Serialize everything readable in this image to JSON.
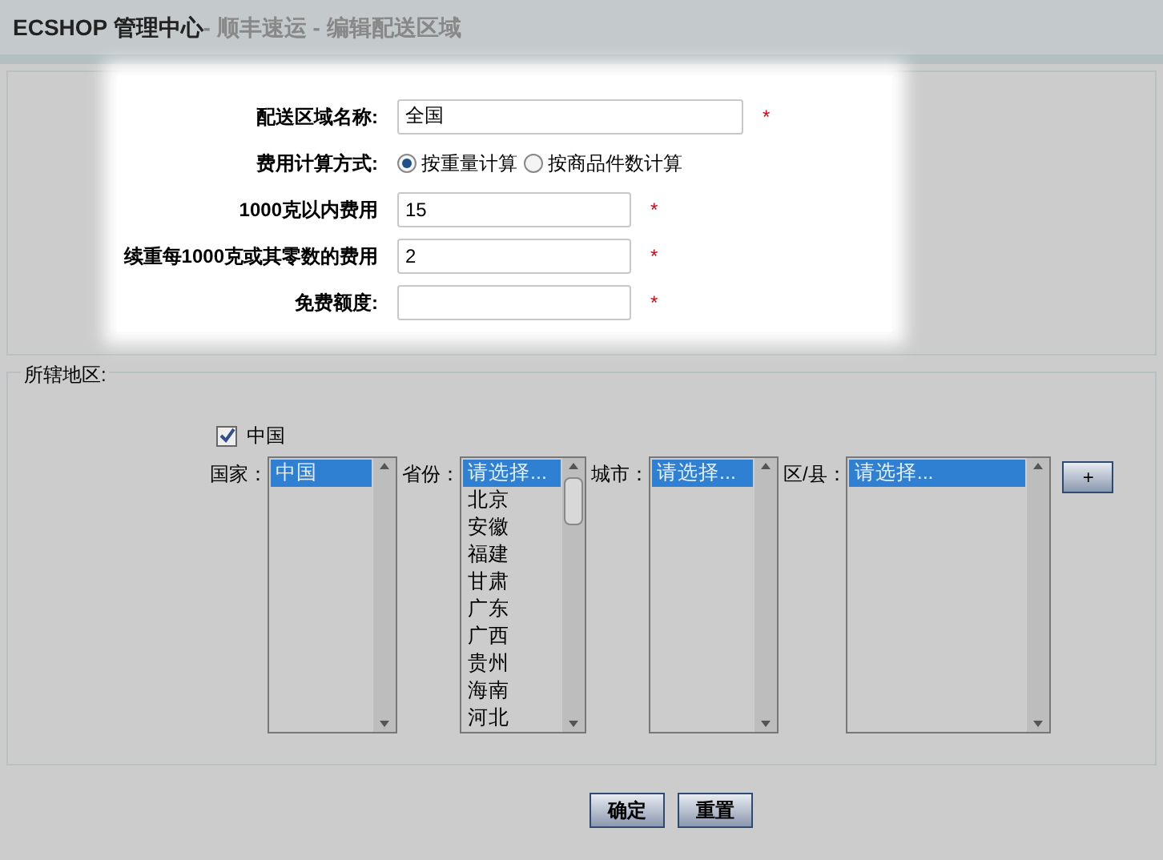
{
  "header": {
    "app": "ECSHOP 管理中心",
    "subtitle": "- 顺丰速运 - 编辑配送区域"
  },
  "form": {
    "fields": [
      {
        "kind": "text",
        "label": "配送区域名称:",
        "value": "全国",
        "required_mark": "*"
      },
      {
        "kind": "radio",
        "label": "费用计算方式:",
        "options": [
          {
            "label": "按重量计算",
            "selected": true
          },
          {
            "label": "按商品件数计算",
            "selected": false
          }
        ]
      },
      {
        "kind": "text",
        "label": "1000克以内费用",
        "value": "15",
        "required_mark": "*"
      },
      {
        "kind": "text",
        "label": "续重每1000克或其零数的费用",
        "value": "2",
        "required_mark": "*"
      },
      {
        "kind": "text",
        "label": "免费额度:",
        "required_mark": "*"
      }
    ]
  },
  "region": {
    "legend": "所辖地区:",
    "area": {
      "label": "中国",
      "checked": true
    },
    "lists": [
      {
        "label": "国家：",
        "options": [
          {
            "text": "中国",
            "selected": true
          }
        ]
      },
      {
        "label": "省份：",
        "options": [
          {
            "text": "请选择...",
            "selected": true
          },
          {
            "text": "北京",
            "selected": false
          },
          {
            "text": "安徽",
            "selected": false
          },
          {
            "text": "福建",
            "selected": false
          },
          {
            "text": "甘肃",
            "selected": false
          },
          {
            "text": "广东",
            "selected": false
          },
          {
            "text": "广西",
            "selected": false
          },
          {
            "text": "贵州",
            "selected": false
          },
          {
            "text": "海南",
            "selected": false
          },
          {
            "text": "河北",
            "selected": false
          }
        ]
      },
      {
        "label": "城市：",
        "options": [
          {
            "text": "请选择...",
            "selected": true
          }
        ]
      },
      {
        "label": "区/县：",
        "options": [
          {
            "text": "请选择...",
            "selected": true
          }
        ]
      }
    ],
    "add_button": "+"
  },
  "buttons": [
    "确定",
    "重置"
  ]
}
